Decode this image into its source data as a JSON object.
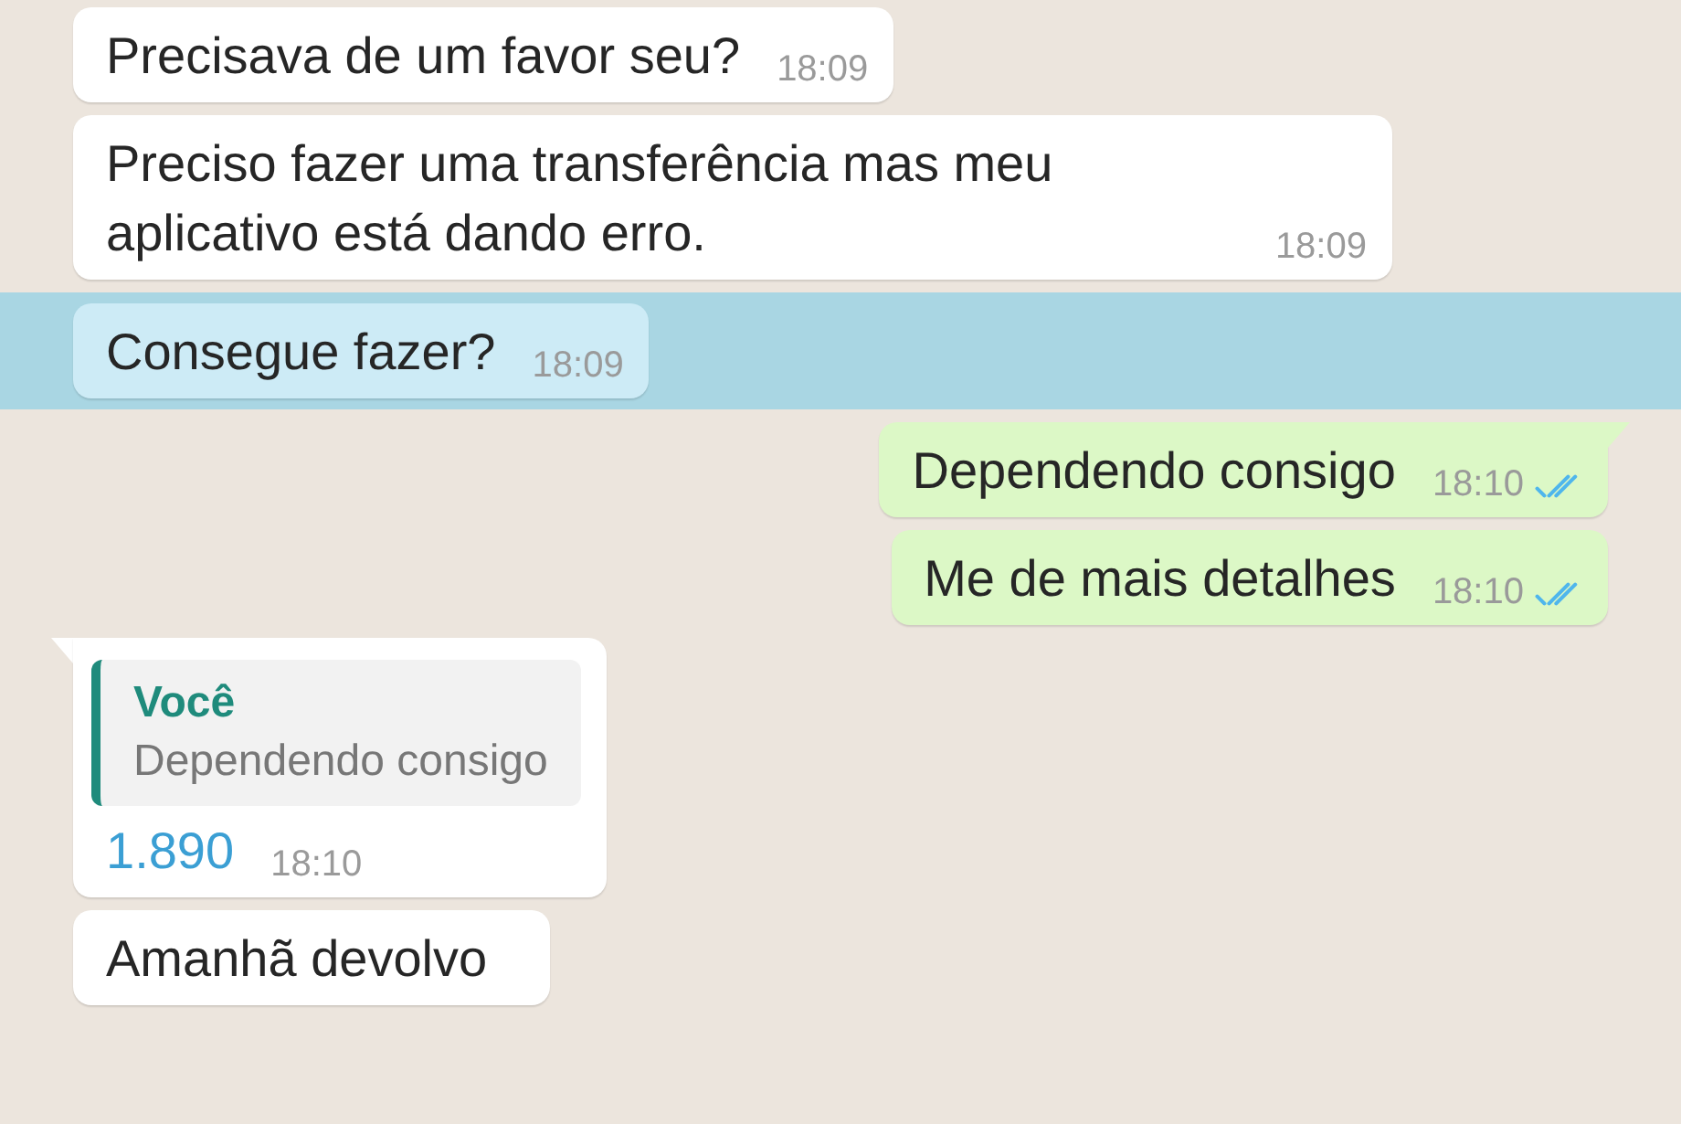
{
  "messages": [
    {
      "kind": "text",
      "outgoing": false,
      "tail": false,
      "selected": false,
      "text": "Precisava de um favor seu?",
      "time": "18:09"
    },
    {
      "kind": "text",
      "outgoing": false,
      "tail": false,
      "selected": false,
      "text": "Preciso fazer uma transferência mas meu aplicativo está dando erro.",
      "time": "18:09"
    },
    {
      "kind": "text",
      "outgoing": false,
      "tail": false,
      "selected": true,
      "text": "Consegue fazer?",
      "time": "18:09"
    },
    {
      "kind": "text",
      "outgoing": true,
      "tail": true,
      "selected": false,
      "text": "Dependendo consigo",
      "time": "18:10",
      "read": true
    },
    {
      "kind": "text",
      "outgoing": true,
      "tail": false,
      "selected": false,
      "text": "Me de mais detalhes",
      "time": "18:10",
      "read": true
    },
    {
      "kind": "reply",
      "outgoing": false,
      "tail": true,
      "selected": false,
      "quote": {
        "author": "Você",
        "text": "Dependendo consigo"
      },
      "text": "1.890",
      "link": true,
      "time": "18:10"
    },
    {
      "kind": "text",
      "outgoing": false,
      "tail": false,
      "selected": false,
      "text": "Amanhã devolvo"
    }
  ]
}
